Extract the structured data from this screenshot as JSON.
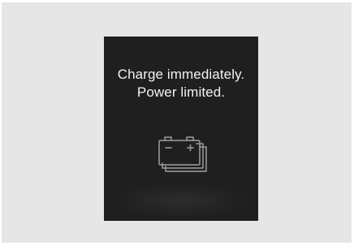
{
  "warning_screen": {
    "message_line_1": "Charge immediately.",
    "message_line_2": "Power limited.",
    "icon": "battery-stack-icon",
    "colors": {
      "page_background": "#e6e6e6",
      "screen_background": "#1f1f1f",
      "text": "#f2f2f2",
      "icon": "#8e8e8e"
    }
  }
}
